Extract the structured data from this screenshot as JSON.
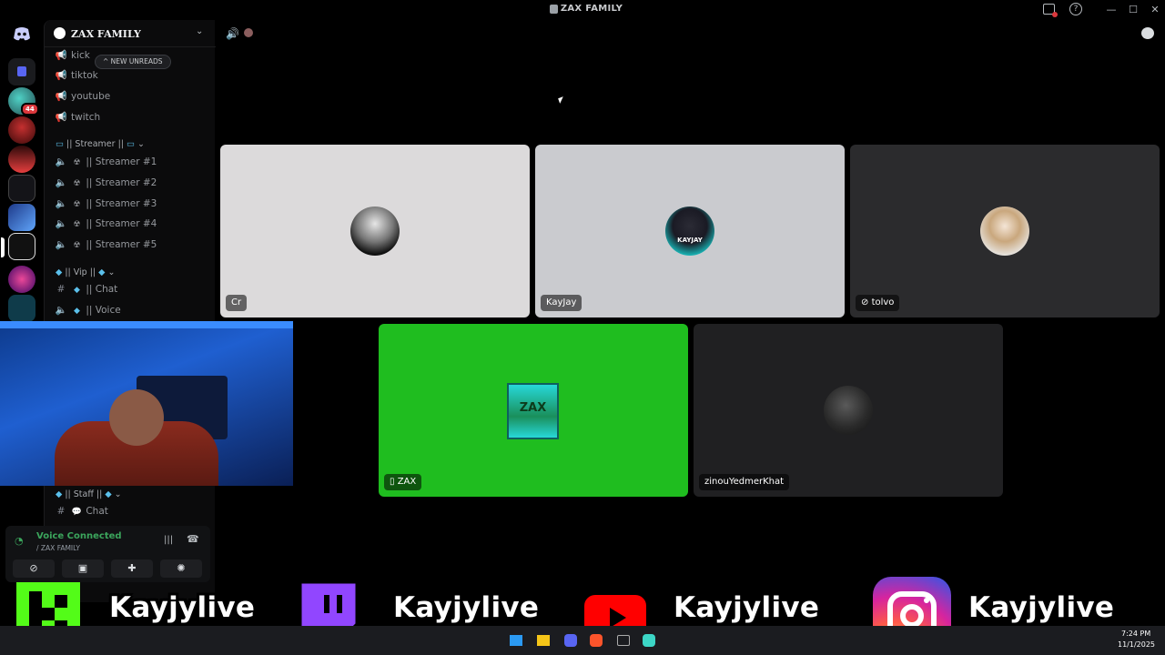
{
  "window": {
    "title": "ZAX FAMILY"
  },
  "guild": {
    "name": "ZAX FAMILY"
  },
  "new_unreads": "NEW UNREADS",
  "channels_top": [
    {
      "name": "kick"
    },
    {
      "name": "tiktok"
    },
    {
      "name": "youtube"
    },
    {
      "name": "twitch"
    }
  ],
  "categories": {
    "streamer": "|| Streamer ||",
    "vip": "|| Vip ||",
    "staff": "|| Staff ||"
  },
  "streamer_channels": [
    {
      "name": "|| Streamer #1"
    },
    {
      "name": "|| Streamer #2"
    },
    {
      "name": "|| Streamer #3"
    },
    {
      "name": "|| Streamer #4"
    },
    {
      "name": "|| Streamer #5"
    }
  ],
  "vip_channels": [
    {
      "name": "|| Chat"
    },
    {
      "name": "|| Voice"
    }
  ],
  "staff_channels": [
    {
      "name": "Chat"
    }
  ],
  "server_badges": [
    "44"
  ],
  "voice": {
    "status": "Voice Connected",
    "channel": "/ ZAX FAMILY"
  },
  "participants": [
    {
      "name": "Cr"
    },
    {
      "name": "KayJay"
    },
    {
      "name": "tolvo"
    },
    {
      "name": "ZAX"
    },
    {
      "name": "zinouYedmerKhat"
    }
  ],
  "avatar_texts": {
    "kayjay": "KAYJAY",
    "zax": "ZAX"
  },
  "social": [
    {
      "platform": "kick",
      "handle": "Kayjylive"
    },
    {
      "platform": "twitch",
      "handle": "Kayjylive"
    },
    {
      "platform": "youtube",
      "handle": "Kayjylive"
    },
    {
      "platform": "instagram",
      "handle": "Kayjylive"
    }
  ],
  "taskbar": {
    "time": "7:24 PM",
    "date": "11/1/2025"
  },
  "colors": {
    "voice_connected": "#3ba55c",
    "zax_tile": "#1fbd1f",
    "kick": "#53fc18",
    "youtube": "#ff0000",
    "twitch": "#9146ff"
  }
}
